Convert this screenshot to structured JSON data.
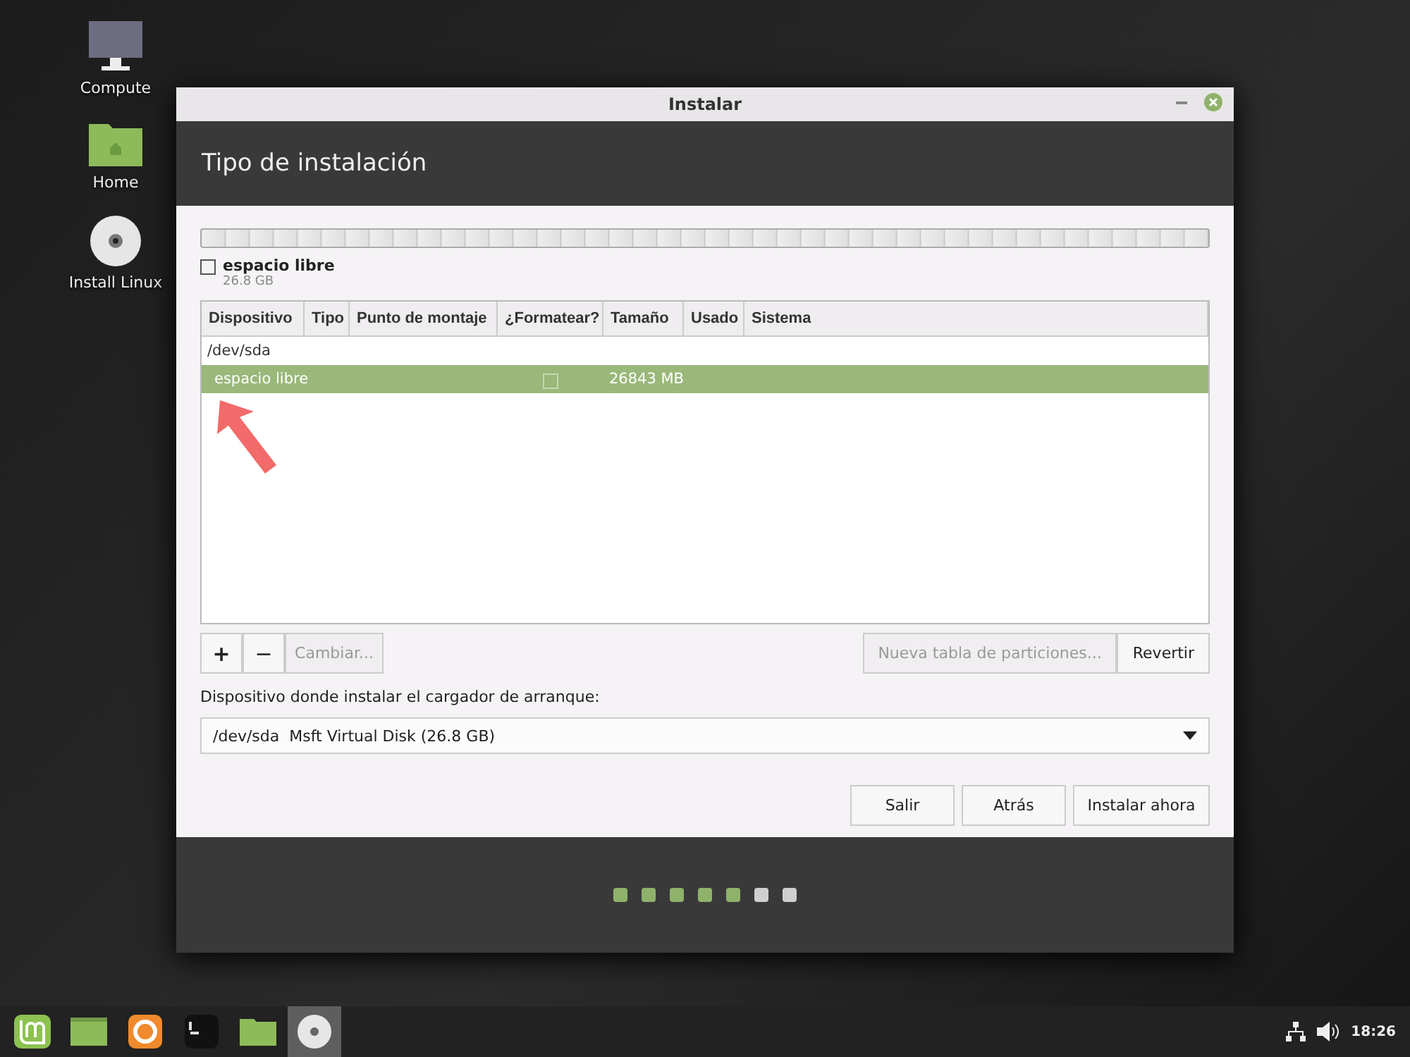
{
  "desktop_icons": [
    {
      "kind": "computer",
      "label": "Compute"
    },
    {
      "kind": "home",
      "label": "Home"
    },
    {
      "kind": "disc",
      "label": "Install Linux"
    }
  ],
  "window": {
    "title": "Instalar",
    "heading": "Tipo de instalación",
    "legend": {
      "label": "espacio libre",
      "size": "26.8 GB",
      "checked": false
    },
    "table": {
      "columns": [
        "Dispositivo",
        "Tipo",
        "Punto de montaje",
        "¿Formatear?",
        "Tamaño",
        "Usado",
        "Sistema"
      ],
      "rows": [
        {
          "kind": "device",
          "device": "/dev/sda",
          "selected": false
        },
        {
          "kind": "partition",
          "device": "espacio libre",
          "format": false,
          "size": "26843 MB",
          "selected": true
        }
      ]
    },
    "edit_buttons": [
      {
        "kind": "add",
        "label": "+",
        "disabled": false
      },
      {
        "kind": "remove",
        "label": "−",
        "disabled": false
      },
      {
        "kind": "change",
        "label": "Cambiar...",
        "disabled": true
      }
    ],
    "table_buttons": [
      {
        "label": "Nueva tabla de particiones...",
        "disabled": true
      },
      {
        "label": "Revertir",
        "disabled": false
      }
    ],
    "bootloader_label": "Dispositivo donde instalar el cargador de arranque:",
    "bootloader_value": "/dev/sda  Msft Virtual Disk (26.8 GB)",
    "nav_buttons": [
      "Salir",
      "Atrás",
      "Instalar ahora"
    ],
    "steps": [
      {
        "done": true
      },
      {
        "done": true
      },
      {
        "done": true
      },
      {
        "done": true
      },
      {
        "done": true
      },
      {
        "done": false
      },
      {
        "done": false
      }
    ]
  },
  "taskbar": {
    "apps": [
      {
        "kind": "menu",
        "active": false
      },
      {
        "kind": "desktop",
        "active": false
      },
      {
        "kind": "browser",
        "active": false
      },
      {
        "kind": "terminal",
        "active": false
      },
      {
        "kind": "folder",
        "active": false
      },
      {
        "kind": "disc",
        "active": true
      }
    ],
    "clock": "18:26"
  }
}
